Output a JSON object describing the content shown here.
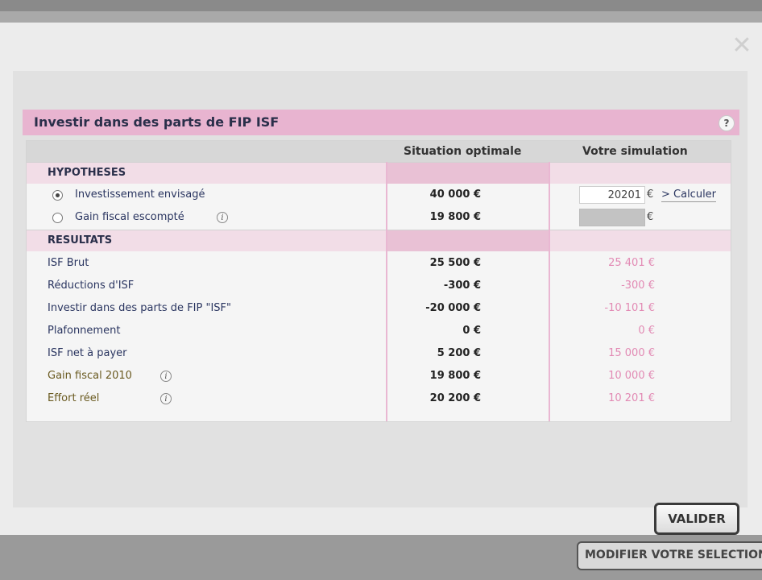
{
  "modal": {
    "title": "Investir dans des parts de FIP ISF",
    "help": "?",
    "close": "✕"
  },
  "columns": {
    "optimal": "Situation optimale",
    "simulation": "Votre simulation"
  },
  "hypotheses": {
    "label": "HYPOTHESES",
    "rows": [
      {
        "label": "Investissement envisagé",
        "optimal": "40 000 €",
        "sim_value": "20201",
        "selected": true
      },
      {
        "label": "Gain fiscal escompté",
        "optimal": "19 800 €",
        "sim_value": "",
        "selected": false
      }
    ],
    "euro": "€",
    "calc_label": "> Calculer"
  },
  "resultats": {
    "label": "RESULTATS",
    "rows": [
      {
        "label": "ISF Brut",
        "optimal": "25 500 €",
        "sim": "25 401 €"
      },
      {
        "label": "Réductions d'ISF",
        "optimal": "-300 €",
        "sim": "-300 €"
      },
      {
        "label": "Investir dans des parts de FIP \"ISF\"",
        "optimal": "-20 000 €",
        "sim": "-10 101 €"
      },
      {
        "label": "Plafonnement",
        "optimal": "0 €",
        "sim": "0 €"
      },
      {
        "label": "ISF net à payer",
        "optimal": "5 200 €",
        "sim": "15 000 €"
      },
      {
        "label": "Gain fiscal 2010",
        "optimal": "19 800 €",
        "sim": "10 000 €"
      },
      {
        "label": "Effort réel",
        "optimal": "20 200 €",
        "sim": "10 201 €"
      }
    ]
  },
  "buttons": {
    "valider": "VALIDER",
    "modifier": "MODIFIER VOTRE SELECTION"
  },
  "colors": {
    "accent_pink": "#e8b4d0",
    "sim_text": "#e28ab4"
  }
}
